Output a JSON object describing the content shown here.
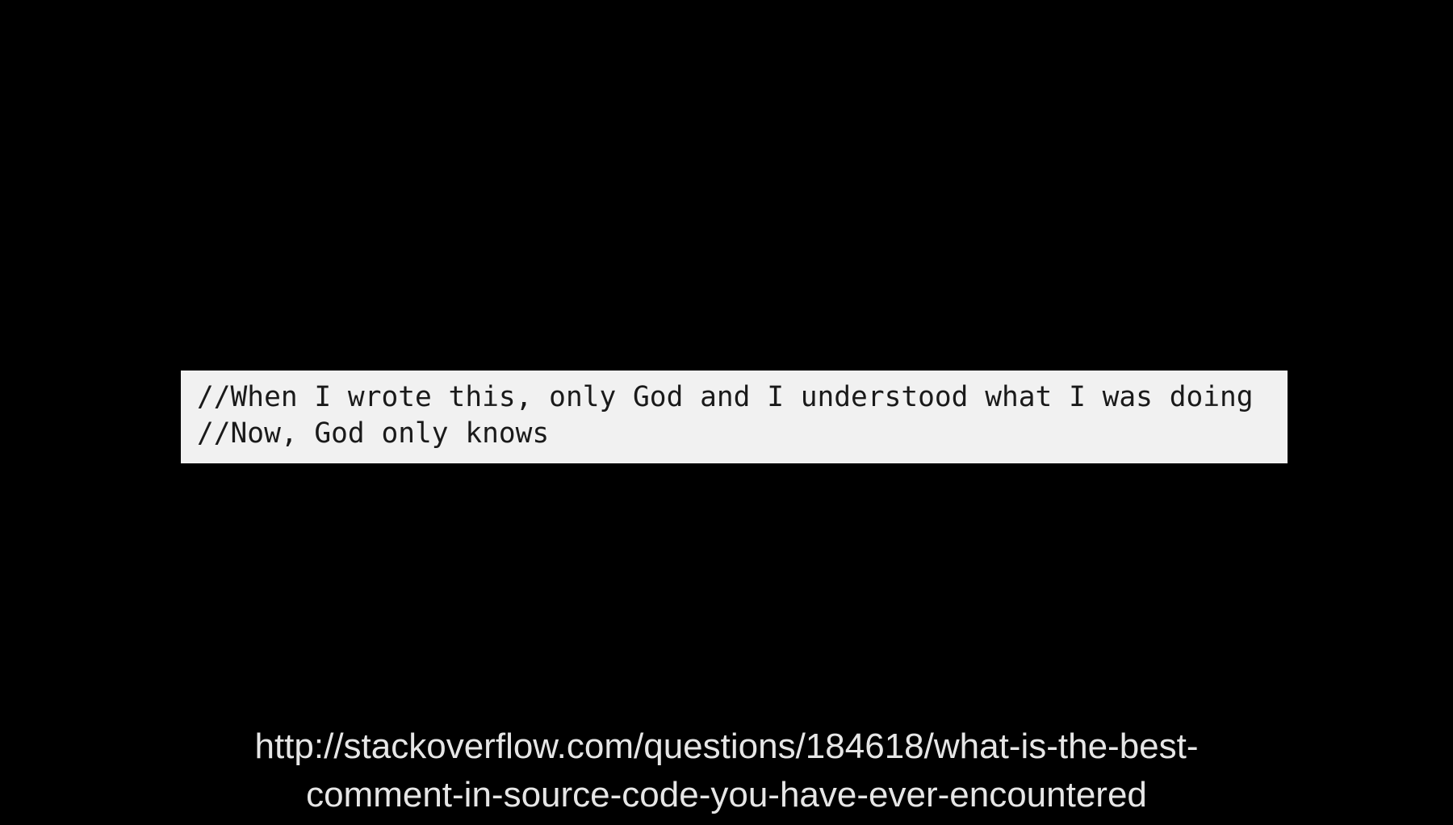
{
  "code_snippet": {
    "lines": [
      "//When I wrote this, only God and I understood what I was doing",
      "//Now, God only knows"
    ]
  },
  "source": {
    "url_line_1": "http://stackoverflow.com/questions/184618/what-is-the-best-",
    "url_line_2": "comment-in-source-code-you-have-ever-encountered"
  },
  "colors": {
    "background": "#000000",
    "code_box_background": "#f1f1f1",
    "code_text": "#1a1a1a",
    "url_text": "#e6e6e6"
  }
}
